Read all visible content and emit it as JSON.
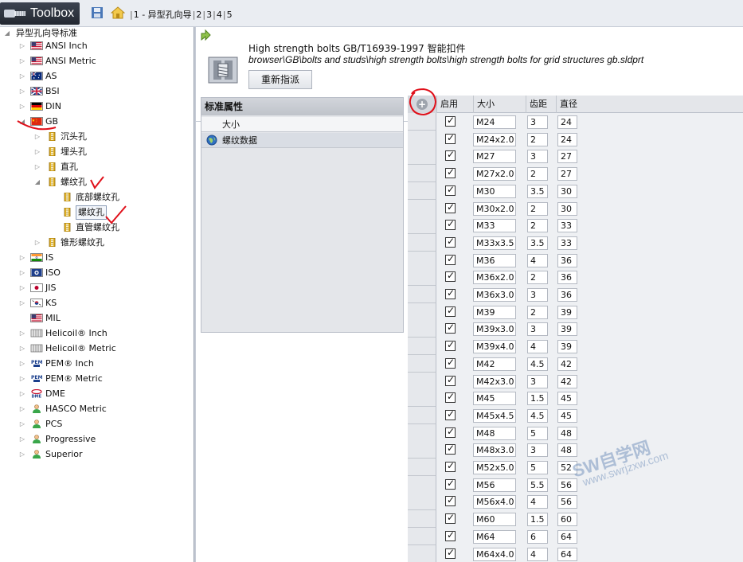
{
  "toolbar": {
    "app_title": "Toolbox",
    "breadcrumbs": [
      "1 - 异型孔向导",
      "2",
      "3",
      "4",
      "5"
    ]
  },
  "tree": {
    "root_label": "异型孔向导标准",
    "items": [
      {
        "label": "ANSI Inch",
        "icon": "us-flag-icon"
      },
      {
        "label": "ANSI Metric",
        "icon": "us-flag-icon"
      },
      {
        "label": "AS",
        "icon": "au-flag-icon"
      },
      {
        "label": "BSI",
        "icon": "uk-flag-icon"
      },
      {
        "label": "DIN",
        "icon": "de-flag-icon"
      },
      {
        "label": "GB",
        "icon": "cn-flag-icon"
      },
      {
        "label": "沉头孔",
        "icon": "hole-icon"
      },
      {
        "label": "埋头孔",
        "icon": "hole-icon"
      },
      {
        "label": "直孔",
        "icon": "hole-icon"
      },
      {
        "label": "螺纹孔",
        "icon": "hole-icon"
      },
      {
        "label": "底部螺纹孔",
        "icon": "hole-icon"
      },
      {
        "label": "螺纹孔",
        "icon": "hole-icon"
      },
      {
        "label": "直管螺纹孔",
        "icon": "hole-icon"
      },
      {
        "label": "锥形螺纹孔",
        "icon": "hole-icon"
      },
      {
        "label": "IS",
        "icon": "in-flag-icon"
      },
      {
        "label": "ISO",
        "icon": "iso-icon"
      },
      {
        "label": "JIS",
        "icon": "jp-flag-icon"
      },
      {
        "label": "KS",
        "icon": "kr-flag-icon"
      },
      {
        "label": "MIL",
        "icon": "us-flag-icon"
      },
      {
        "label": "Helicoil® Inch",
        "icon": "helicoil-icon"
      },
      {
        "label": "Helicoil® Metric",
        "icon": "helicoil-icon"
      },
      {
        "label": "PEM® Inch",
        "icon": "pem-icon"
      },
      {
        "label": "PEM® Metric",
        "icon": "pem-icon"
      },
      {
        "label": "DME",
        "icon": "dme-icon"
      },
      {
        "label": "HASCO Metric",
        "icon": "person-icon"
      },
      {
        "label": "PCS",
        "icon": "person-icon"
      },
      {
        "label": "Progressive",
        "icon": "person-icon"
      },
      {
        "label": "Superior",
        "icon": "person-icon"
      }
    ],
    "icon_labels": {
      "pem": "PEM",
      "dme": "DME"
    }
  },
  "part": {
    "title": "High strength bolts GB/T16939-1997 智能扣件",
    "path": "browser\\GB\\bolts and studs\\high strength bolts\\high strength bolts for grid structures gb.sldprt",
    "reassign_button": "重新指派"
  },
  "properties": {
    "title": "标准属性",
    "rows": [
      "大小",
      "螺纹数据"
    ]
  },
  "table": {
    "add_button": "+",
    "columns": [
      "启用",
      "大小",
      "齿距",
      "直径"
    ],
    "rows": [
      {
        "enabled": true,
        "size": "M24",
        "pitch": "3",
        "diameter": "24"
      },
      {
        "enabled": true,
        "size": "M24x2.0",
        "pitch": "2",
        "diameter": "24"
      },
      {
        "enabled": true,
        "size": "M27",
        "pitch": "3",
        "diameter": "27"
      },
      {
        "enabled": true,
        "size": "M27x2.0",
        "pitch": "2",
        "diameter": "27"
      },
      {
        "enabled": true,
        "size": "M30",
        "pitch": "3.5",
        "diameter": "30"
      },
      {
        "enabled": true,
        "size": "M30x2.0",
        "pitch": "2",
        "diameter": "30"
      },
      {
        "enabled": true,
        "size": "M33",
        "pitch": "2",
        "diameter": "33"
      },
      {
        "enabled": true,
        "size": "M33x3.5",
        "pitch": "3.5",
        "diameter": "33"
      },
      {
        "enabled": true,
        "size": "M36",
        "pitch": "4",
        "diameter": "36"
      },
      {
        "enabled": true,
        "size": "M36x2.0",
        "pitch": "2",
        "diameter": "36"
      },
      {
        "enabled": true,
        "size": "M36x3.0",
        "pitch": "3",
        "diameter": "36"
      },
      {
        "enabled": true,
        "size": "M39",
        "pitch": "2",
        "diameter": "39"
      },
      {
        "enabled": true,
        "size": "M39x3.0",
        "pitch": "3",
        "diameter": "39"
      },
      {
        "enabled": true,
        "size": "M39x4.0",
        "pitch": "4",
        "diameter": "39"
      },
      {
        "enabled": true,
        "size": "M42",
        "pitch": "4.5",
        "diameter": "42"
      },
      {
        "enabled": true,
        "size": "M42x3.0",
        "pitch": "3",
        "diameter": "42"
      },
      {
        "enabled": true,
        "size": "M45",
        "pitch": "1.5",
        "diameter": "45"
      },
      {
        "enabled": true,
        "size": "M45x4.5",
        "pitch": "4.5",
        "diameter": "45"
      },
      {
        "enabled": true,
        "size": "M48",
        "pitch": "5",
        "diameter": "48"
      },
      {
        "enabled": true,
        "size": "M48x3.0",
        "pitch": "3",
        "diameter": "48"
      },
      {
        "enabled": true,
        "size": "M52x5.0",
        "pitch": "5",
        "diameter": "52"
      },
      {
        "enabled": true,
        "size": "M56",
        "pitch": "5.5",
        "diameter": "56"
      },
      {
        "enabled": true,
        "size": "M56x4.0",
        "pitch": "4",
        "diameter": "56"
      },
      {
        "enabled": true,
        "size": "M60",
        "pitch": "1.5",
        "diameter": "60"
      },
      {
        "enabled": true,
        "size": "M64",
        "pitch": "6",
        "diameter": "64"
      },
      {
        "enabled": true,
        "size": "M64x4.0",
        "pitch": "4",
        "diameter": "64"
      }
    ]
  },
  "watermark": {
    "main": "SW自学网",
    "url": "www.swrjzxw.com"
  },
  "colors": {
    "annotation": "#e0101a"
  }
}
